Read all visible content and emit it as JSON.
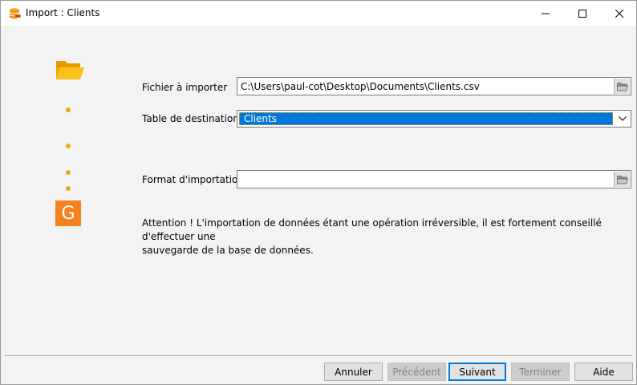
{
  "window": {
    "title": "Import : Clients",
    "controls": {
      "minimize": "minimize",
      "maximize": "maximize",
      "close": "close"
    }
  },
  "sidebar": {
    "logo_letter": "G",
    "accent": "#f58220"
  },
  "form": {
    "file": {
      "label": "Fichier à importer",
      "value": "C:\\Users\\paul-cot\\Desktop\\Documents\\Clients.csv"
    },
    "table": {
      "label": "Table de destination",
      "value": "Clients"
    },
    "format": {
      "label": "Format d'importation",
      "value": ""
    }
  },
  "warning_line1": "Attention ! L'importation de données étant une opération irréversible, il est fortement conseillé d'effectuer une",
  "warning_line2": "sauvegarde de la base de données.",
  "buttons": {
    "cancel": "Annuler",
    "previous": "Précédent",
    "next": "Suivant",
    "finish": "Terminer",
    "help": "Aide"
  },
  "icons": [
    "database-icon",
    "folder-open-icon",
    "browse-folder-icon",
    "dropdown-chevron-icon",
    "minimize-icon",
    "maximize-icon",
    "close-icon"
  ]
}
